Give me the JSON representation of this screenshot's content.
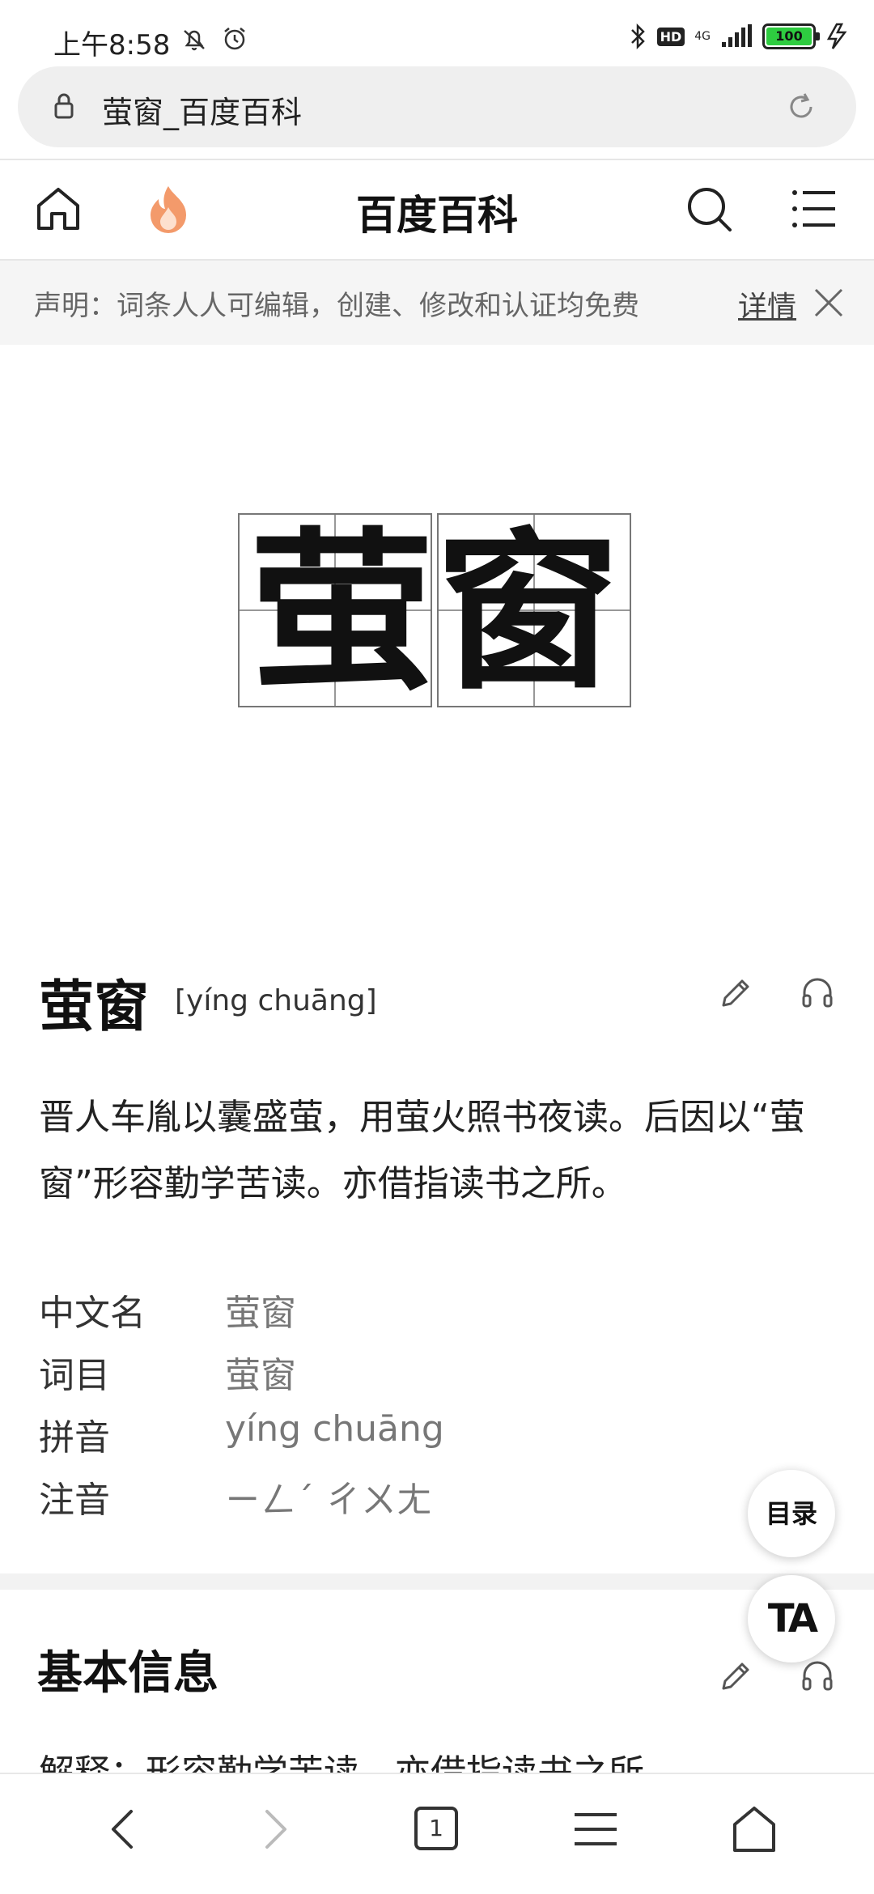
{
  "status_bar": {
    "time": "上午8:58",
    "hd": "HD",
    "network": "4G",
    "battery": "100"
  },
  "url_bar": {
    "text": "萤窗_百度百科"
  },
  "header": {
    "title": "百度百科"
  },
  "notice": {
    "text": "声明：词条人人可编辑，创建、修改和认证均免费",
    "detail_label": "详情"
  },
  "entry": {
    "title": "萤窗",
    "pinyin": "[yíng chuāng]",
    "summary": "晋人车胤以囊盛萤，用萤火照书夜读。后因以“萤窗”形容勤学苦读。亦借指读书之所。",
    "info": [
      {
        "key": "中文名",
        "value": "萤窗"
      },
      {
        "key": "词目",
        "value": "萤窗"
      },
      {
        "key": "拼音",
        "value": "yíng chuāng"
      },
      {
        "key": "注音",
        "value": "ㄧㄥˊ ㄔㄨㄤ"
      }
    ]
  },
  "floating": {
    "toc_label": "目录",
    "ta_label": "TA"
  },
  "section": {
    "title": "基本信息",
    "peek": "解释：形容勤学苦读，亦借指读书之所"
  },
  "bottom_nav": {
    "tab_count": "1"
  },
  "colors": {
    "battery_green": "#2ecc40",
    "hot_icon": "#f39a6b",
    "url_bar_bg": "#efefef"
  }
}
